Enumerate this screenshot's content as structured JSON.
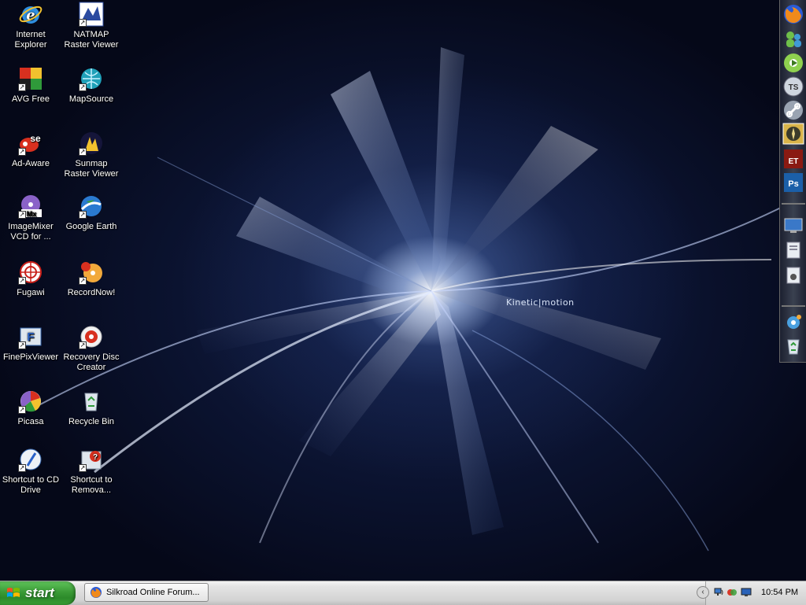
{
  "wallpaper": {
    "brand_text": "Kinetic|motion"
  },
  "desktop_icons": [
    {
      "id": "internet-explorer",
      "label": "Internet\nExplorer",
      "icon": "ie-icon"
    },
    {
      "id": "natmap",
      "label": "NATMAP\nRaster Viewer",
      "icon": "natmap-icon"
    },
    {
      "id": "avg",
      "label": "AVG Free",
      "icon": "avg-icon"
    },
    {
      "id": "mapsource",
      "label": "MapSource",
      "icon": "mapsource-icon"
    },
    {
      "id": "adaware",
      "label": "Ad-Aware",
      "icon": "adaware-icon"
    },
    {
      "id": "sunmap",
      "label": "Sunmap\nRaster Viewer",
      "icon": "sunmap-icon"
    },
    {
      "id": "imagemixer",
      "label": "ImageMixer\nVCD for ...",
      "icon": "imagemixer-icon"
    },
    {
      "id": "google-earth",
      "label": "Google Earth",
      "icon": "google-earth-icon"
    },
    {
      "id": "fugawi",
      "label": "Fugawi",
      "icon": "fugawi-icon"
    },
    {
      "id": "recordnow",
      "label": "RecordNow!",
      "icon": "recordnow-icon"
    },
    {
      "id": "finepix",
      "label": "FinePixViewer",
      "icon": "finepix-icon"
    },
    {
      "id": "recovery",
      "label": "Recovery Disc\nCreator",
      "icon": "recovery-disc-icon"
    },
    {
      "id": "picasa",
      "label": "Picasa",
      "icon": "picasa-icon"
    },
    {
      "id": "recycle",
      "label": "Recycle Bin",
      "icon": "recycle-bin-icon"
    },
    {
      "id": "cd-drive",
      "label": "Shortcut to CD\nDrive",
      "icon": "cd-drive-icon"
    },
    {
      "id": "removable",
      "label": "Shortcut to\nRemova...",
      "icon": "removable-drive-icon"
    }
  ],
  "dock": {
    "items": [
      "firefox-icon",
      "messenger-icon",
      "media-icon",
      "teamspeak-icon",
      "link-icon",
      "compass-icon",
      "game-icon",
      "photoshop-icon",
      "monitor-icon",
      "documents-icon",
      "pictures-icon",
      "settings-icon",
      "recycle-icon"
    ]
  },
  "taskbar": {
    "start_label": "start",
    "task_label": "Silkroad Online Forum...",
    "clock": "10:54 PM"
  },
  "colors": {
    "start_green": "#3a9a36",
    "taskbar_gray": "#d3d3d3",
    "wallpaper_dark": "#05081a"
  }
}
